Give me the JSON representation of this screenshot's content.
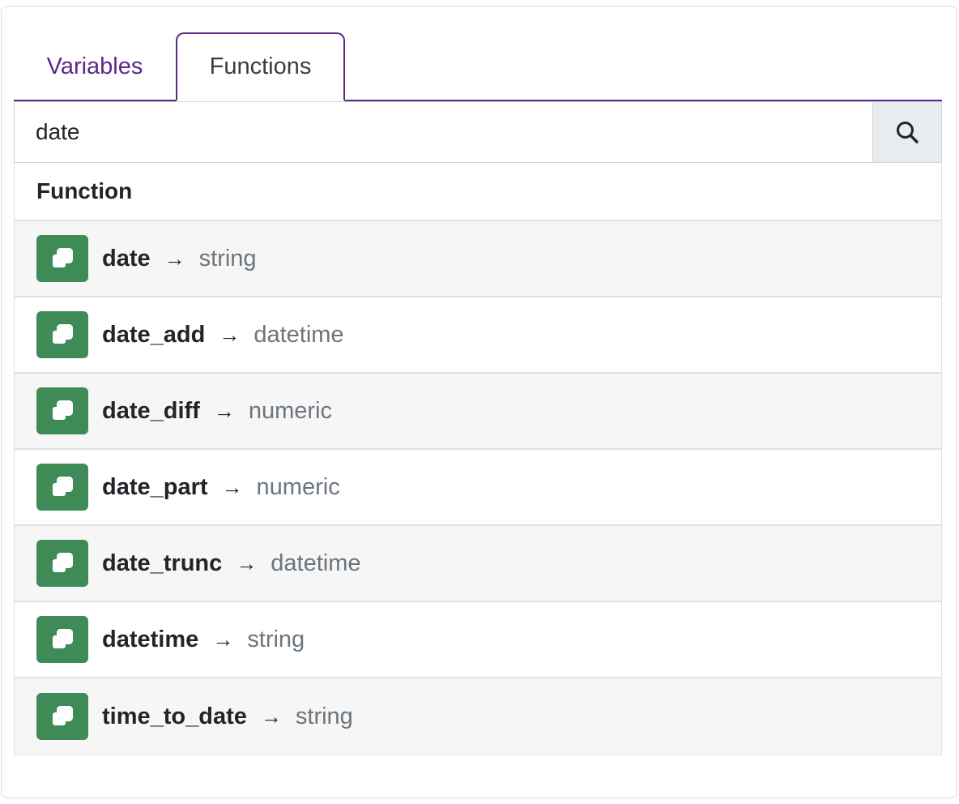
{
  "tabs": [
    {
      "label": "Variables",
      "active": false
    },
    {
      "label": "Functions",
      "active": true
    }
  ],
  "search": {
    "value": "date",
    "button_icon": "search-icon"
  },
  "list": {
    "header": "Function",
    "arrow": "→",
    "items": [
      {
        "name": "date",
        "return_type": "string",
        "icon": "function-icon"
      },
      {
        "name": "date_add",
        "return_type": "datetime",
        "icon": "function-icon"
      },
      {
        "name": "date_diff",
        "return_type": "numeric",
        "icon": "function-icon"
      },
      {
        "name": "date_part",
        "return_type": "numeric",
        "icon": "function-icon"
      },
      {
        "name": "date_trunc",
        "return_type": "datetime",
        "icon": "function-icon"
      },
      {
        "name": "datetime",
        "return_type": "string",
        "icon": "function-icon"
      },
      {
        "name": "time_to_date",
        "return_type": "string",
        "icon": "function-icon"
      }
    ]
  },
  "colors": {
    "accent": "#5b2a86",
    "icon_bg": "#3e8b57",
    "type_text": "#6c757d",
    "row_alt": "#f6f6f6"
  }
}
